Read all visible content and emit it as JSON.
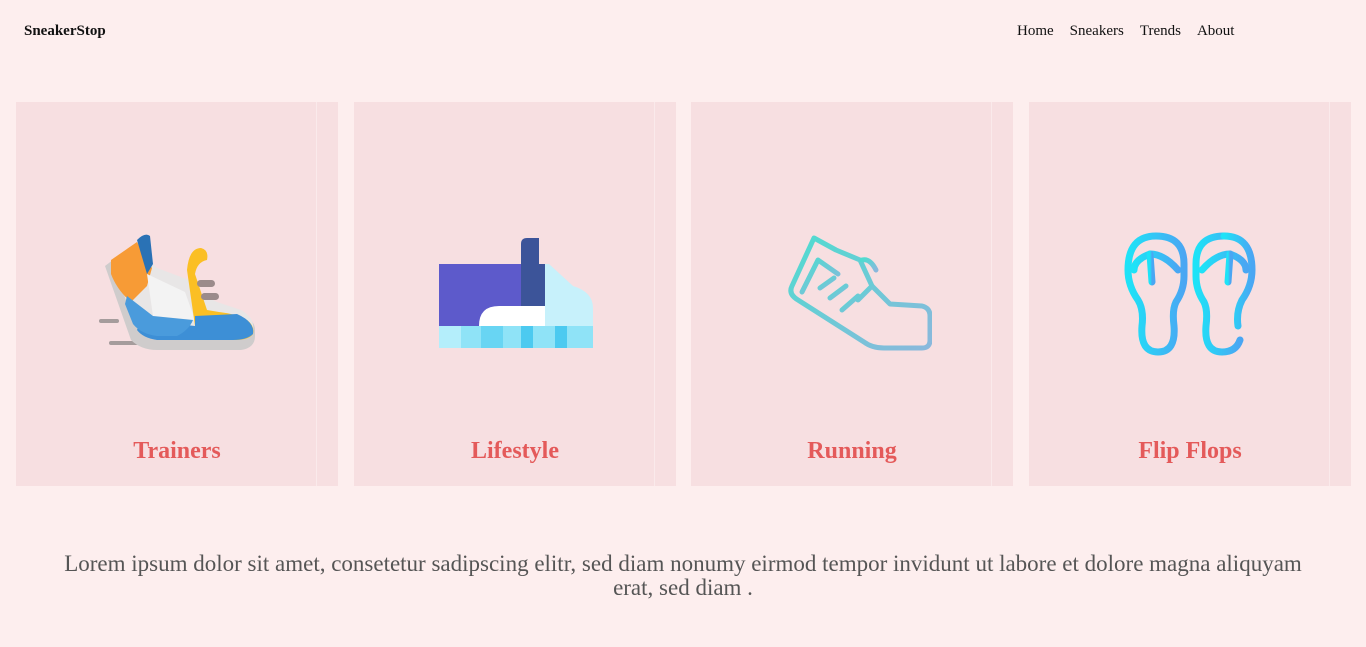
{
  "header": {
    "brand": "SneakerStop",
    "nav": [
      "Home",
      "Sneakers",
      "Trends",
      "About"
    ]
  },
  "categories": [
    {
      "label": "Trainers",
      "icon": "trainer-shoe-icon"
    },
    {
      "label": "Lifestyle",
      "icon": "high-top-shoe-icon"
    },
    {
      "label": "Running",
      "icon": "running-shoe-icon"
    },
    {
      "label": "Flip Flops",
      "icon": "flip-flops-icon"
    }
  ],
  "body_text": "Lorem ipsum dolor sit amet, consetetur sadipscing elitr, sed diam nonumy eirmod tempor invidunt ut labore et dolore magna aliquyam erat, sed diam .",
  "colors": {
    "page_background": "#fdeeee",
    "card_background": "#f7dfe1",
    "card_label": "#e45a5a",
    "body_text": "#555555"
  }
}
